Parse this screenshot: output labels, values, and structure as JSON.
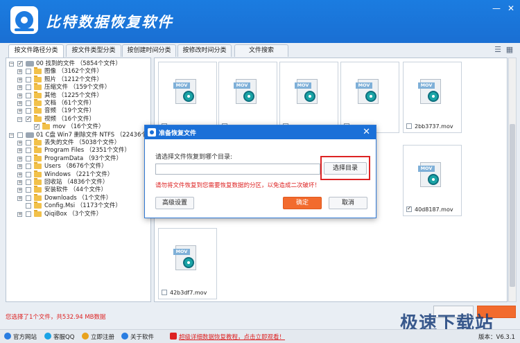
{
  "app": {
    "title": "比特数据恢复软件",
    "window_controls": [
      "—",
      "✕"
    ]
  },
  "tabs": [
    {
      "label": "按文件路径分类",
      "active": true
    },
    {
      "label": "按文件类型分类",
      "active": false
    },
    {
      "label": "按创建时间分类",
      "active": false
    },
    {
      "label": "按修改时间分类",
      "active": false
    },
    {
      "label": "文件搜索",
      "active": false
    }
  ],
  "tree": [
    {
      "label": "00 找到的文件 （5854个文件）",
      "level": 0,
      "expander": "−",
      "checked": true,
      "icon": "drive"
    },
    {
      "label": "图像 （3162个文件）",
      "level": 1,
      "expander": "+",
      "checked": false,
      "icon": "folder"
    },
    {
      "label": "照片 （1212个文件）",
      "level": 1,
      "expander": "+",
      "checked": false,
      "icon": "folder"
    },
    {
      "label": "压缩文件 （159个文件）",
      "level": 1,
      "expander": "+",
      "checked": false,
      "icon": "folder"
    },
    {
      "label": "其他 （1225个文件）",
      "level": 1,
      "expander": "+",
      "checked": false,
      "icon": "folder"
    },
    {
      "label": "文档 （61个文件）",
      "level": 1,
      "expander": "+",
      "checked": false,
      "icon": "folder"
    },
    {
      "label": "音频 （19个文件）",
      "level": 1,
      "expander": "+",
      "checked": false,
      "icon": "folder"
    },
    {
      "label": "视频 （16个文件）",
      "level": 1,
      "expander": "−",
      "checked": true,
      "icon": "folder"
    },
    {
      "label": "mov （16个文件）",
      "level": 2,
      "expander": "",
      "checked": true,
      "icon": "folder"
    },
    {
      "label": "01 C盘 Win7 删除文件 NTFS （22436个文件）",
      "level": 0,
      "expander": "−",
      "checked": false,
      "icon": "drive"
    },
    {
      "label": "丢失的文件 （5038个文件）",
      "level": 1,
      "expander": "+",
      "checked": false,
      "icon": "folder"
    },
    {
      "label": "Program Files （2351个文件）",
      "level": 1,
      "expander": "+",
      "checked": false,
      "icon": "folder"
    },
    {
      "label": "ProgramData （93个文件）",
      "level": 1,
      "expander": "+",
      "checked": false,
      "icon": "folder"
    },
    {
      "label": "Users （8676个文件）",
      "level": 1,
      "expander": "+",
      "checked": false,
      "icon": "folder"
    },
    {
      "label": "Windows （221个文件）",
      "level": 1,
      "expander": "+",
      "checked": false,
      "icon": "folder"
    },
    {
      "label": "回收站 （4836个文件）",
      "level": 1,
      "expander": "+",
      "checked": false,
      "icon": "folder"
    },
    {
      "label": "安装软件 （44个文件）",
      "level": 1,
      "expander": "+",
      "checked": false,
      "icon": "folder"
    },
    {
      "label": "Downloads （1个文件）",
      "level": 1,
      "expander": "+",
      "checked": false,
      "icon": "folder"
    },
    {
      "label": "Config.Msi （1173个文件）",
      "level": 1,
      "expander": "",
      "checked": false,
      "icon": "folder"
    },
    {
      "label": "QiqiBox （3个文件）",
      "level": 1,
      "expander": "+",
      "checked": false,
      "icon": "folder"
    }
  ],
  "files": [
    {
      "badge": "MOV",
      "name": "",
      "checked": false
    },
    {
      "badge": "MOV",
      "name": "",
      "checked": false
    },
    {
      "badge": "MOV",
      "name": "",
      "checked": false
    },
    {
      "badge": "MOV",
      "name": "",
      "checked": false
    },
    {
      "badge": "MOV",
      "name": "2bb3737.mov",
      "checked": false
    },
    {
      "badge": "MOV",
      "name": "40d8187.mov",
      "checked": true
    },
    {
      "badge": "MOV",
      "name": "42b3df7.mov",
      "checked": false
    }
  ],
  "dialog": {
    "title": "准备恢复文件",
    "close": "✕",
    "prompt": "请选择文件恢复到哪个目录:",
    "path_value": "",
    "browse_label": "选择目录",
    "warning": "请勿将文件恢复到您需要恢复数据的分区，以免造成二次破坏！",
    "advanced_label": "高级设置",
    "ok_label": "确定",
    "cancel_label": "取消"
  },
  "status": {
    "selection": "您选择了1个文件，共532.94 MB数据"
  },
  "footer": {
    "items": [
      {
        "label": "官方网站",
        "color": "#2a7de1"
      },
      {
        "label": "客服QQ",
        "color": "#1aa3e6"
      },
      {
        "label": "立即注册",
        "color": "#e8a21c"
      },
      {
        "label": "关于软件",
        "color": "#2a7de1"
      }
    ],
    "ad": "超级详细数据恢复教程，点击立即观看！",
    "version": "版本：V6.3.1"
  },
  "watermark": "极速下载站"
}
